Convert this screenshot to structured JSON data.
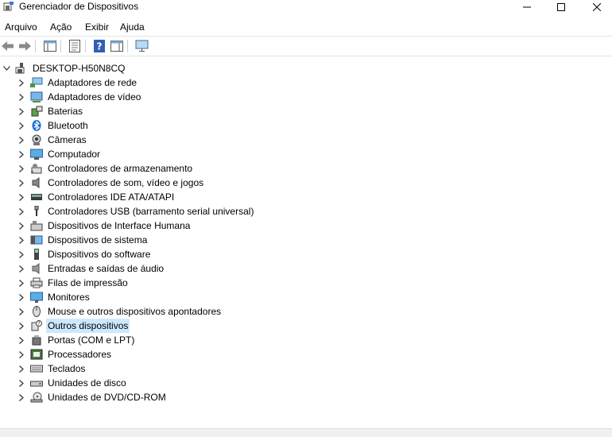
{
  "window": {
    "title": "Gerenciador de Dispositivos"
  },
  "menu": [
    "Arquivo",
    "Ação",
    "Exibir",
    "Ajuda"
  ],
  "toolbar": {
    "buttons": [
      "back-icon",
      "forward-icon",
      "console-tree-icon",
      "properties-icon",
      "help-icon",
      "action-pane-icon",
      "monitor-scan-icon"
    ]
  },
  "tree": {
    "root": "DESKTOP-H50N8CQ",
    "items": [
      {
        "label": "Adaptadores de rede",
        "icon": "network-adapter-icon"
      },
      {
        "label": "Adaptadores de vídeo",
        "icon": "display-adapter-icon"
      },
      {
        "label": "Baterias",
        "icon": "battery-icon"
      },
      {
        "label": "Bluetooth",
        "icon": "bluetooth-icon"
      },
      {
        "label": "Câmeras",
        "icon": "camera-icon"
      },
      {
        "label": "Computador",
        "icon": "computer-icon"
      },
      {
        "label": "Controladores de armazenamento",
        "icon": "storage-controller-icon"
      },
      {
        "label": "Controladores de som, vídeo e jogos",
        "icon": "speaker-icon"
      },
      {
        "label": "Controladores IDE ATA/ATAPI",
        "icon": "ide-controller-icon"
      },
      {
        "label": "Controladores USB (barramento serial universal)",
        "icon": "usb-icon"
      },
      {
        "label": "Dispositivos de Interface Humana",
        "icon": "hid-icon"
      },
      {
        "label": "Dispositivos de sistema",
        "icon": "system-device-icon"
      },
      {
        "label": "Dispositivos do software",
        "icon": "software-device-icon"
      },
      {
        "label": "Entradas e saídas de áudio",
        "icon": "audio-io-icon"
      },
      {
        "label": "Filas de impressão",
        "icon": "printer-icon"
      },
      {
        "label": "Monitores",
        "icon": "monitor-icon"
      },
      {
        "label": "Mouse e outros dispositivos apontadores",
        "icon": "mouse-icon"
      },
      {
        "label": "Outros dispositivos",
        "icon": "unknown-device-icon",
        "selected": true
      },
      {
        "label": "Portas (COM e LPT)",
        "icon": "port-icon"
      },
      {
        "label": "Processadores",
        "icon": "processor-icon"
      },
      {
        "label": "Teclados",
        "icon": "keyboard-icon"
      },
      {
        "label": "Unidades de disco",
        "icon": "disk-drive-icon"
      },
      {
        "label": "Unidades de DVD/CD-ROM",
        "icon": "dvd-drive-icon"
      }
    ]
  },
  "colors": {
    "selection": "#cce8ff",
    "accent": "#1e90ff"
  }
}
